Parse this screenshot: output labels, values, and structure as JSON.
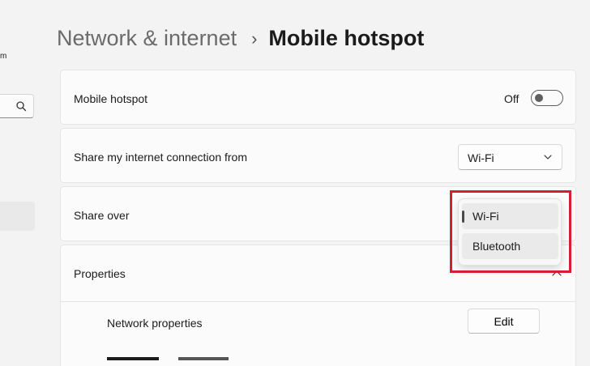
{
  "sidebar": {
    "user_fragment": "m"
  },
  "breadcrumb": {
    "parent": "Network & internet",
    "separator": "›",
    "current": "Mobile hotspot"
  },
  "hotspot": {
    "label": "Mobile hotspot",
    "state_text": "Off",
    "toggle_on": false
  },
  "share_from": {
    "label": "Share my internet connection from",
    "selected": "Wi-Fi"
  },
  "share_over": {
    "label": "Share over",
    "options": [
      "Wi-Fi",
      "Bluetooth"
    ],
    "selected": "Wi-Fi"
  },
  "properties": {
    "label": "Properties",
    "network_properties_label": "Network properties",
    "edit_label": "Edit"
  },
  "colors": {
    "highlight": "#d61f2a",
    "background": "#f3f3f3",
    "card": "#fbfbfb"
  }
}
